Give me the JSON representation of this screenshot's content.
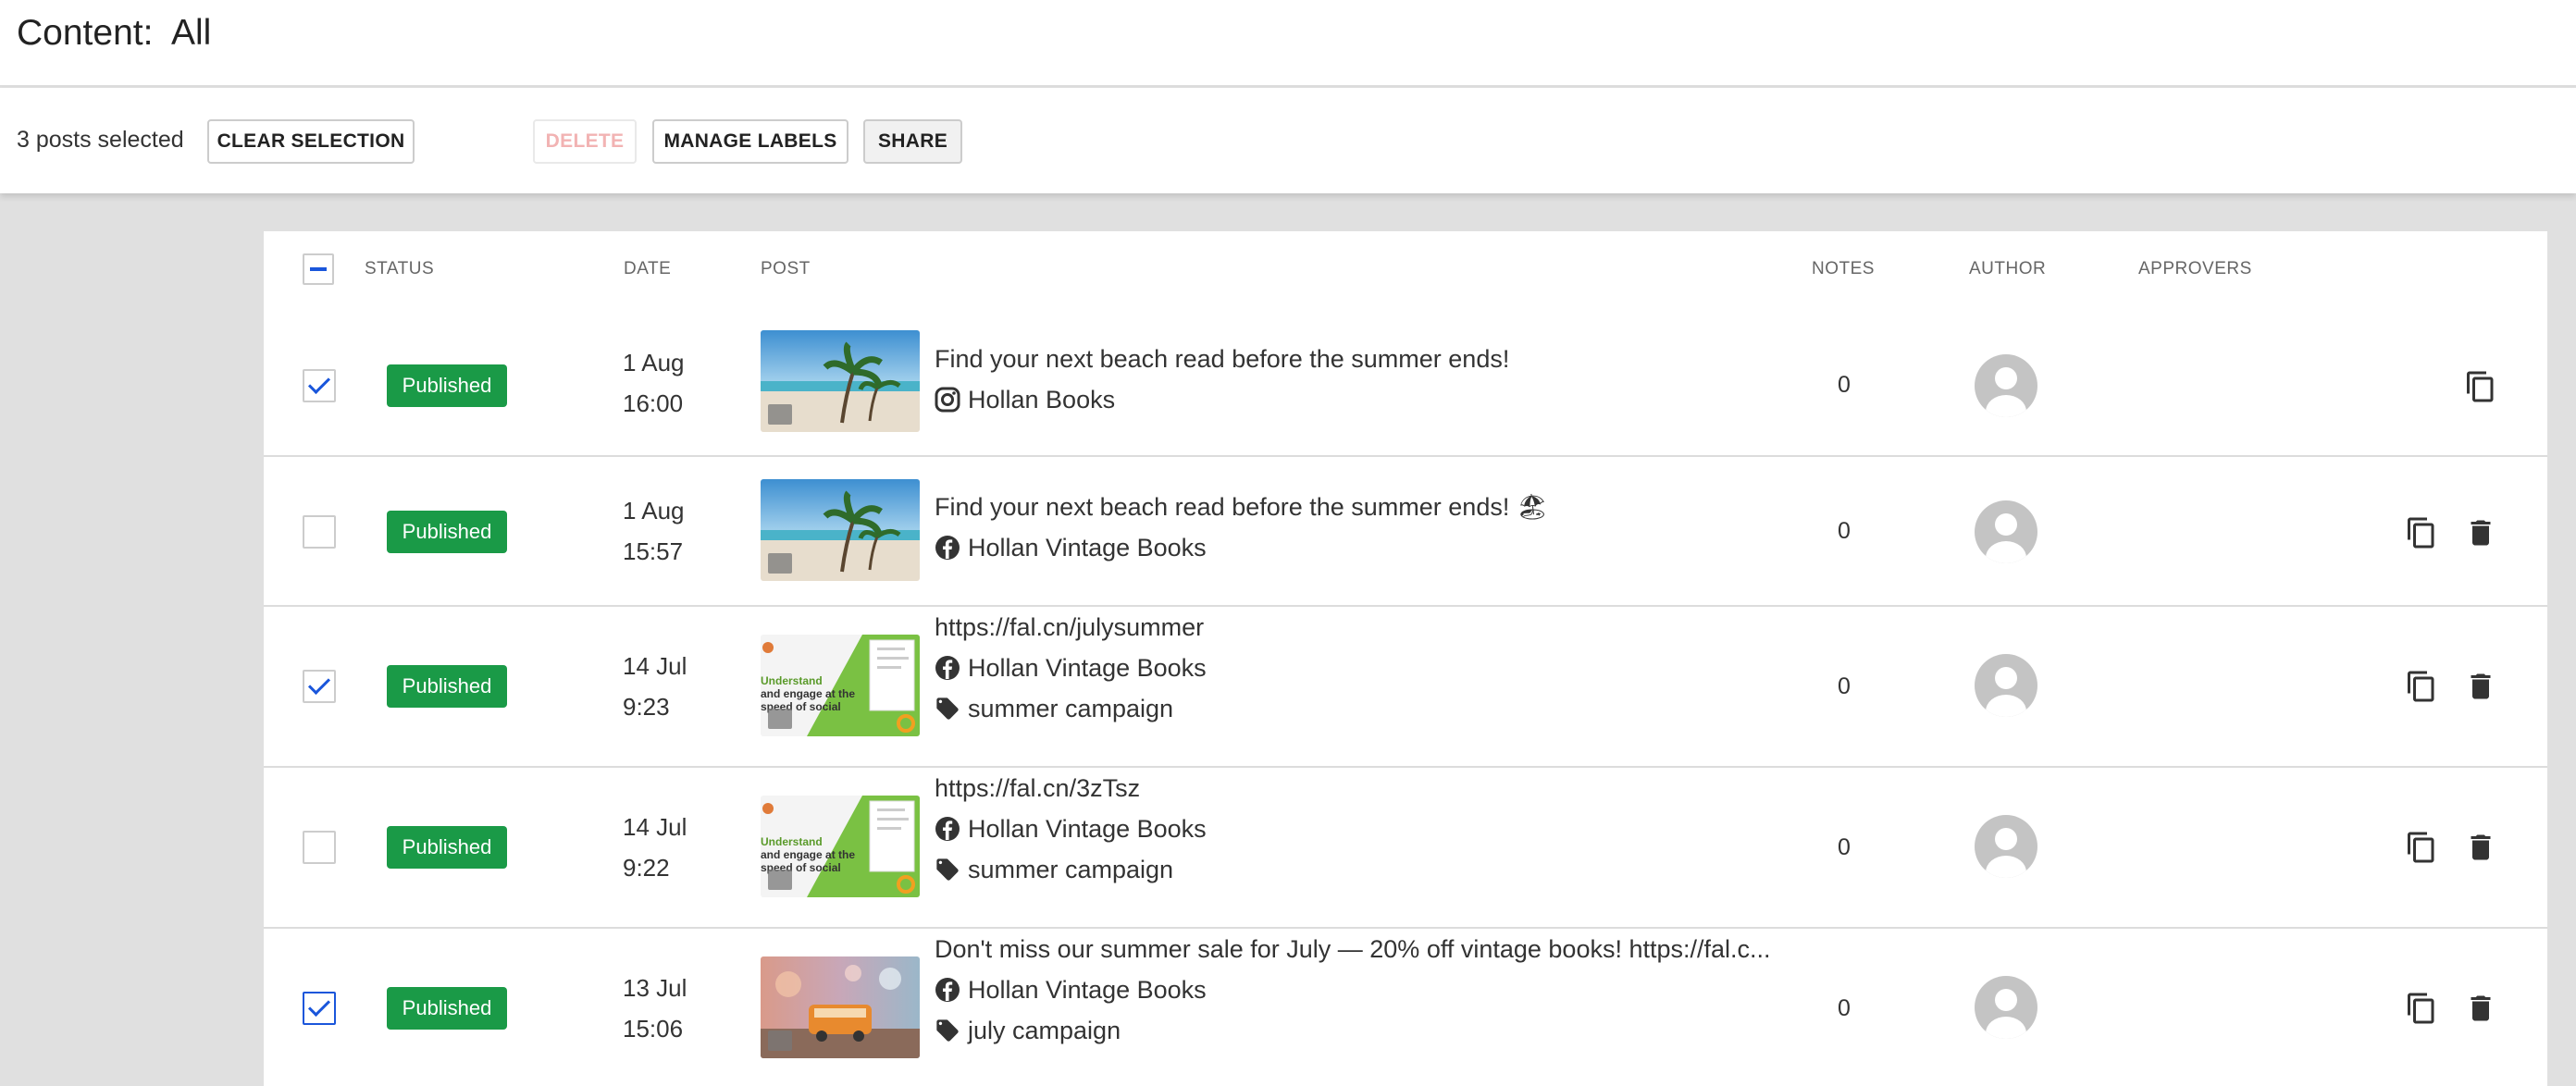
{
  "header": {
    "title": "Content:  All"
  },
  "toolbar": {
    "selected_count": "3 posts selected",
    "clear_label": "CLEAR SELECTION",
    "delete_label": "DELETE",
    "labels_label": "MANAGE LABELS",
    "share_label": "SHARE"
  },
  "table": {
    "columns": {
      "status": "STATUS",
      "date": "DATE",
      "post": "POST",
      "notes": "NOTES",
      "author": "AUTHOR",
      "approvers": "APPROVERS"
    },
    "rows": [
      {
        "checked": true,
        "status": "Published",
        "day": "1 Aug",
        "time": "16:00",
        "thumb": "beach-image",
        "text": "Find your next beach read before the summer ends!",
        "network": "instagram-icon",
        "account": "Hollan Books",
        "label": "",
        "notes": "0"
      },
      {
        "checked": false,
        "status": "Published",
        "day": "1 Aug",
        "time": "15:57",
        "thumb": "beach-image",
        "text": "Find your next beach read before the summer ends! 🏖",
        "network": "facebook-icon",
        "account": "Hollan Vintage Books",
        "label": "",
        "notes": "0"
      },
      {
        "checked": true,
        "status": "Published",
        "day": "14 Jul",
        "time": "9:23",
        "thumb": "link-preview",
        "text": "https://fal.cn/julysummer",
        "network": "facebook-icon",
        "account": "Hollan Vintage Books",
        "label": "summer campaign",
        "notes": "0"
      },
      {
        "checked": false,
        "status": "Published",
        "day": "14 Jul",
        "time": "9:22",
        "thumb": "link-preview",
        "text": "https://fal.cn/3zTsz",
        "network": "facebook-icon",
        "account": "Hollan Vintage Books",
        "label": "summer campaign",
        "notes": "0"
      },
      {
        "checked": true,
        "status": "Published",
        "day": "13 Jul",
        "time": "15:06",
        "thumb": "van-image",
        "text": "Don't miss our summer sale for July — 20% off vintage books! https://fal.c...",
        "network": "facebook-icon",
        "account": "Hollan Vintage Books",
        "label": "july campaign",
        "notes": "0"
      }
    ]
  },
  "thumb_text": {
    "line1": "Understand",
    "line2": "and engage at the",
    "line3": "speed of social"
  },
  "colors": {
    "published": "#1a9a47",
    "accent": "#1a56db",
    "brand_green": "#7ac143"
  }
}
